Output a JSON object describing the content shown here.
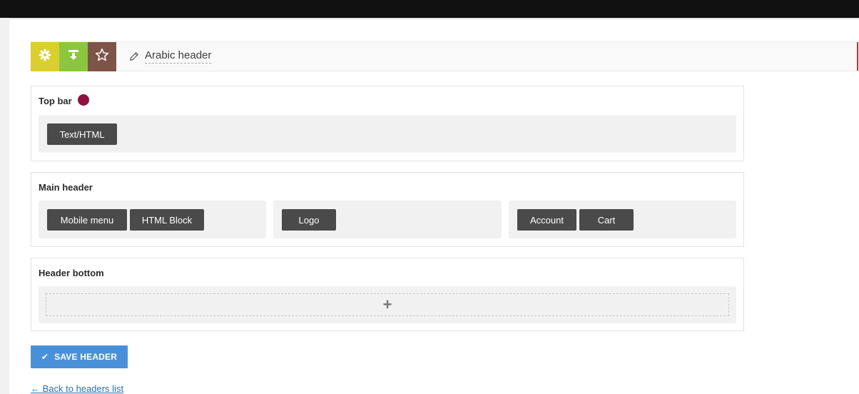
{
  "header_editor": {
    "title": "Arabic header",
    "icons": [
      "gear-icon",
      "download-icon",
      "star-icon",
      "pencil-icon"
    ],
    "colors": {
      "settings": "#d9cf2e",
      "download": "#8cc63f",
      "favorite": "#7d5548"
    }
  },
  "sections": {
    "top_bar": {
      "label": "Top bar",
      "indicator_color": "#8e1240",
      "elements": [
        "Text/HTML"
      ]
    },
    "main_header": {
      "label": "Main header",
      "left": [
        "Mobile menu",
        "HTML Block"
      ],
      "center": [
        "Logo"
      ],
      "right": [
        "Account",
        "Cart"
      ]
    },
    "header_bottom": {
      "label": "Header bottom",
      "add_symbol": "+"
    }
  },
  "actions": {
    "save_label": "SAVE HEADER",
    "save_icon": "✔",
    "back_link": "← Back to headers list"
  }
}
